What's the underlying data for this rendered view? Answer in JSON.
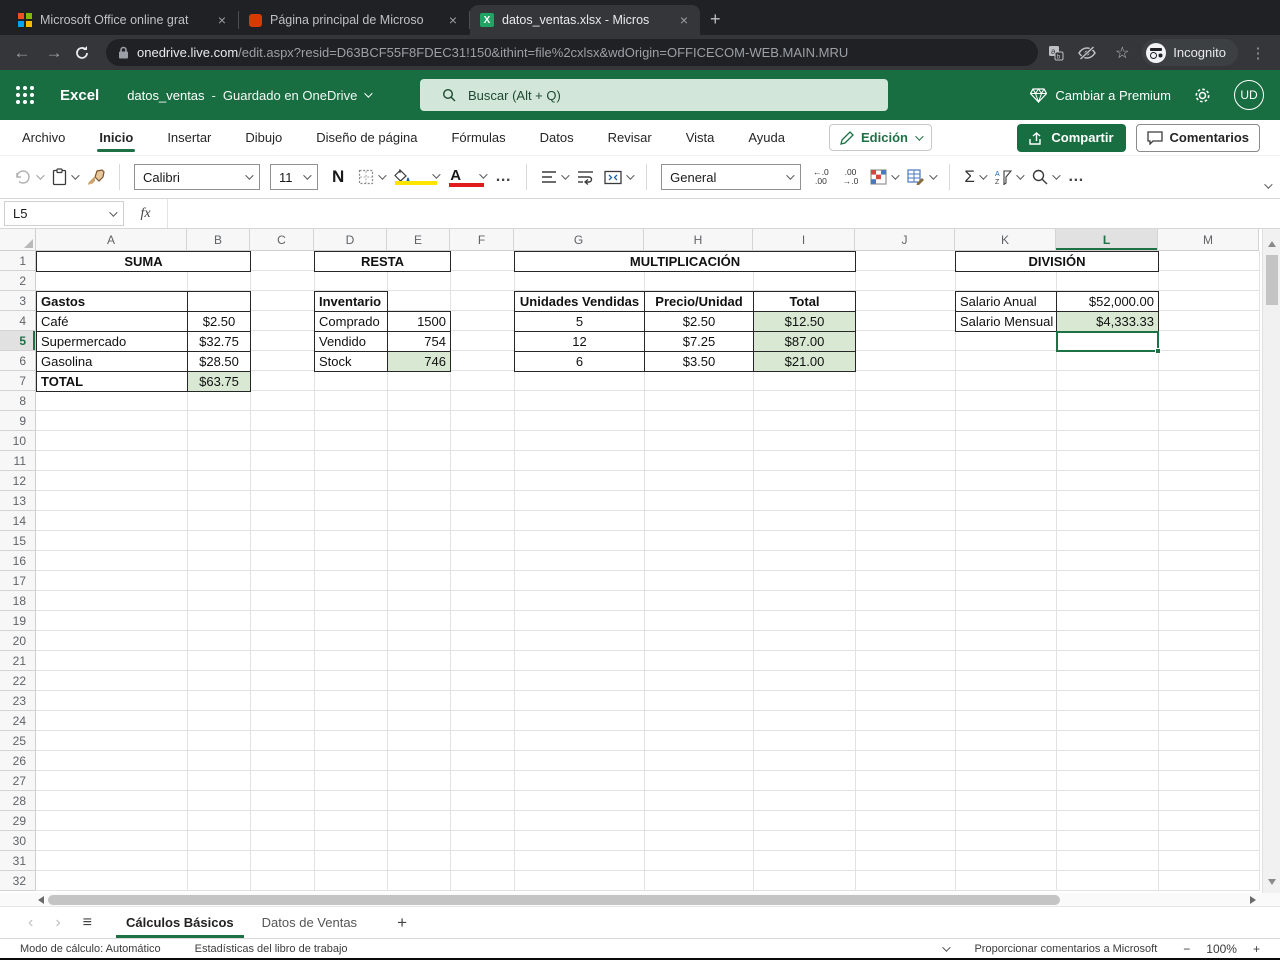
{
  "colors": {
    "excel_green": "#1e7145",
    "header_green": "#186e41",
    "search_box_green": "#d3e6da",
    "cell_fill_green": "#d8e8d2",
    "font_color_red": "#e01b1b",
    "fill_color_yellow": "#ffe400",
    "ms_logo": [
      "#f25022",
      "#7fba00",
      "#00a4ef",
      "#ffb900"
    ],
    "office_logo_orange": "#d83b01",
    "excel_icon_green": "#21a366"
  },
  "icons": {
    "close": "×",
    "new_tab": "+",
    "back": "←",
    "forward": "→",
    "star": "☆",
    "menu_vertical": "⋮",
    "overflow": "…",
    "sigma": "Σ",
    "hamburger": "≡",
    "prev_sheet": "‹",
    "next_sheet": "›",
    "add_sheet": "+",
    "zoom_out": "−",
    "zoom_in": "+",
    "excel_logo_letter": "X",
    "bold_label": "N",
    "dec_decrease_top": "←.0",
    "dec_decrease_bottom": ".00",
    "dec_increase_top": ".00",
    "dec_increase_bottom": "→.0"
  },
  "browser": {
    "tabs": [
      {
        "title": "Microsoft Office online grat",
        "icon": "microsoft-logo",
        "active": false
      },
      {
        "title": "Página principal de Microso",
        "icon": "office-logo",
        "active": false
      },
      {
        "title": "datos_ventas.xlsx - Micros",
        "icon": "excel-logo",
        "active": true
      }
    ],
    "url_host": "onedrive.live.com",
    "url_path": "/edit.aspx?resid=D63BCF55F8FDEC31!150&ithint=file%2cxlsx&wdOrigin=OFFICECOM-WEB.MAIN.MRU",
    "incognito_label": "Incognito"
  },
  "header": {
    "app_name": "Excel",
    "doc_title": "datos_ventas",
    "separator": "-",
    "save_status": "Guardado en OneDrive",
    "search_placeholder": "Buscar (Alt + Q)",
    "premium_label": "Cambiar a Premium",
    "avatar_initials": "UD"
  },
  "ribbon": {
    "tabs": [
      "Archivo",
      "Inicio",
      "Insertar",
      "Dibujo",
      "Diseño de página",
      "Fórmulas",
      "Datos",
      "Revisar",
      "Vista",
      "Ayuda"
    ],
    "active_tab": "Inicio",
    "mode_label": "Edición",
    "share_label": "Compartir",
    "comments_label": "Comentarios",
    "font_name": "Calibri",
    "font_size": "11",
    "number_format": "General"
  },
  "formula_bar": {
    "name_box": "L5",
    "fx_label": "fx",
    "formula": ""
  },
  "grid": {
    "columns": [
      "A",
      "B",
      "C",
      "D",
      "E",
      "F",
      "G",
      "H",
      "I",
      "J",
      "K",
      "L",
      "M"
    ],
    "row_count": 32,
    "selected_column": "L",
    "selected_row": 5,
    "active_cell": "L5",
    "cells": [
      {
        "ref": "A1",
        "span": 2,
        "text": "SUMA",
        "bold": true,
        "align": "center"
      },
      {
        "ref": "D1",
        "span": 2,
        "text": "RESTA",
        "bold": true,
        "align": "center"
      },
      {
        "ref": "G1",
        "span": 3,
        "text": "MULTIPLICACIÓN",
        "bold": true,
        "align": "center"
      },
      {
        "ref": "K1",
        "span": 2,
        "text": "DIVISIÓN",
        "bold": true,
        "align": "center"
      },
      {
        "ref": "A3",
        "text": "Gastos",
        "bold": true
      },
      {
        "ref": "B3",
        "text": ""
      },
      {
        "ref": "A4",
        "text": "Café"
      },
      {
        "ref": "B4",
        "text": "$2.50",
        "align": "center"
      },
      {
        "ref": "A5",
        "text": "Supermercado"
      },
      {
        "ref": "B5",
        "text": "$32.75",
        "align": "center"
      },
      {
        "ref": "A6",
        "text": "Gasolina"
      },
      {
        "ref": "B6",
        "text": "$28.50",
        "align": "center"
      },
      {
        "ref": "A7",
        "text": "TOTAL",
        "bold": true
      },
      {
        "ref": "B7",
        "text": "$63.75",
        "align": "center",
        "fill": true
      },
      {
        "ref": "D3",
        "text": "Inventario",
        "bold": true
      },
      {
        "ref": "D4",
        "text": "Comprado"
      },
      {
        "ref": "E4",
        "text": "1500",
        "align": "right"
      },
      {
        "ref": "D5",
        "text": "Vendido"
      },
      {
        "ref": "E5",
        "text": "754",
        "align": "right"
      },
      {
        "ref": "D6",
        "text": "Stock"
      },
      {
        "ref": "E6",
        "text": "746",
        "align": "right",
        "fill": true
      },
      {
        "ref": "G3",
        "text": "Unidades Vendidas",
        "bold": true,
        "align": "center"
      },
      {
        "ref": "H3",
        "text": "Precio/Unidad",
        "bold": true,
        "align": "center"
      },
      {
        "ref": "I3",
        "text": "Total",
        "bold": true,
        "align": "center"
      },
      {
        "ref": "G4",
        "text": "5",
        "align": "center"
      },
      {
        "ref": "H4",
        "text": "$2.50",
        "align": "center"
      },
      {
        "ref": "I4",
        "text": "$12.50",
        "align": "center",
        "fill": true
      },
      {
        "ref": "G5",
        "text": "12",
        "align": "center"
      },
      {
        "ref": "H5",
        "text": "$7.25",
        "align": "center"
      },
      {
        "ref": "I5",
        "text": "$87.00",
        "align": "center",
        "fill": true
      },
      {
        "ref": "G6",
        "text": "6",
        "align": "center"
      },
      {
        "ref": "H6",
        "text": "$3.50",
        "align": "center"
      },
      {
        "ref": "I6",
        "text": "$21.00",
        "align": "center",
        "fill": true
      },
      {
        "ref": "K3",
        "text": "Salario Anual"
      },
      {
        "ref": "L3",
        "text": "$52,000.00",
        "align": "right"
      },
      {
        "ref": "K4",
        "text": "Salario Mensual"
      },
      {
        "ref": "L4",
        "text": "$4,333.33",
        "align": "right",
        "fill": true
      }
    ]
  },
  "sheet_bar": {
    "sheets": [
      {
        "name": "Cálculos Básicos",
        "active": true
      },
      {
        "name": "Datos de Ventas",
        "active": false
      }
    ]
  },
  "status_bar": {
    "calc_mode": "Modo de cálculo: Automático",
    "stats": "Estadísticas del libro de trabajo",
    "feedback": "Proporcionar comentarios a Microsoft",
    "zoom_level": "100%"
  }
}
